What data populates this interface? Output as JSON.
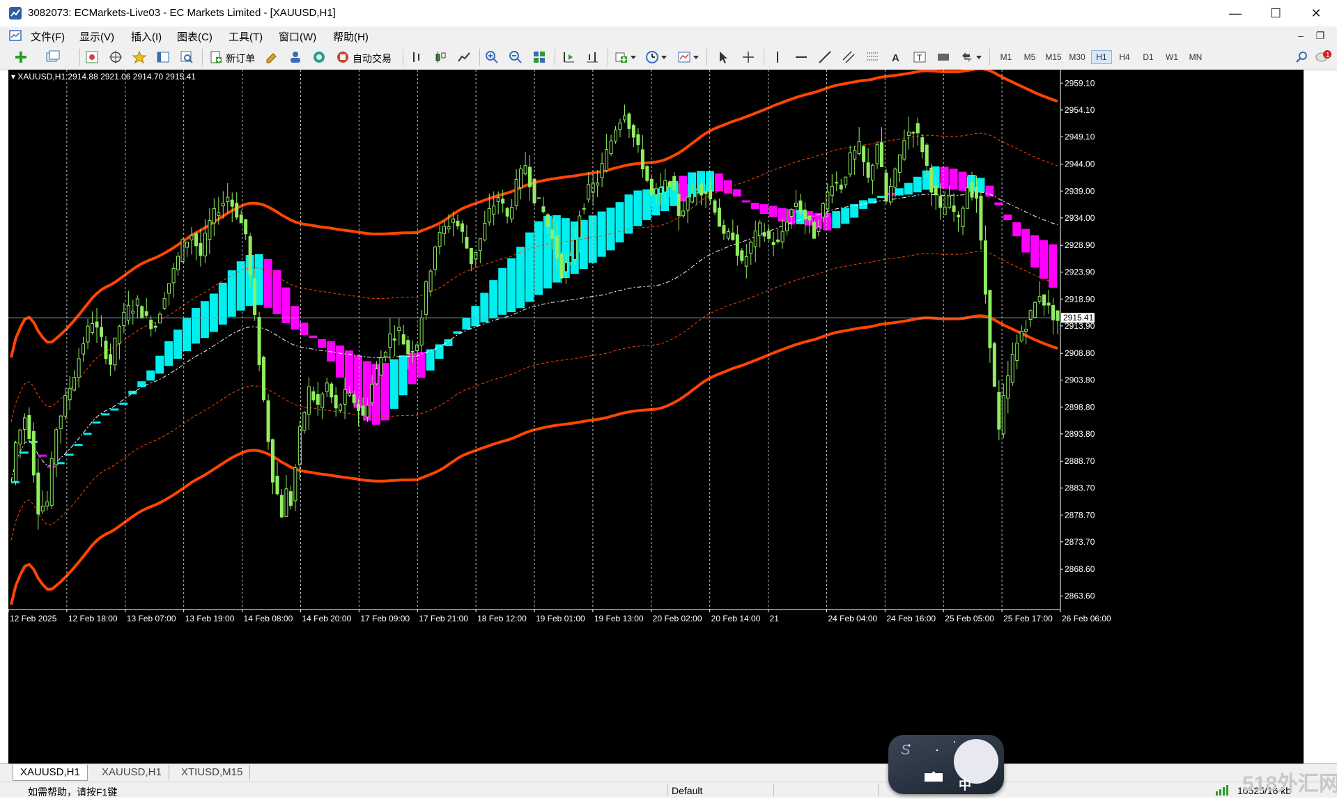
{
  "window": {
    "title": "3082073: ECMarkets-Live03 - EC Markets Limited - [XAUUSD,H1]",
    "minimize": "—",
    "maximize": "☐",
    "close": "✕"
  },
  "menu": {
    "items": [
      "文件(F)",
      "显示(V)",
      "插入(I)",
      "图表(C)",
      "工具(T)",
      "窗口(W)",
      "帮助(H)"
    ],
    "mdi_minimize": "‒",
    "mdi_restore": "❐"
  },
  "toolbar": {
    "new_order": "新订单",
    "auto_trading": "自动交易",
    "timeframes": [
      "M1",
      "M5",
      "M15",
      "M30",
      "H1",
      "H4",
      "D1",
      "W1",
      "MN"
    ],
    "active_timeframe": "H1",
    "notification_count": "1"
  },
  "chart": {
    "header": "XAUUSD,H1  2914.88 2921.06 2914.70 2915.41",
    "current_price_label": "2915.41",
    "price_ticks": [
      "2959.10",
      "2954.10",
      "2949.10",
      "2944.00",
      "2939.00",
      "2934.00",
      "2928.90",
      "2923.90",
      "2918.90",
      "2913.90",
      "2908.80",
      "2903.80",
      "2898.80",
      "2893.80",
      "2888.70",
      "2883.70",
      "2878.70",
      "2873.70",
      "2868.60",
      "2863.60"
    ],
    "time_ticks": [
      "12 Feb 2025",
      "12 Feb 18:00",
      "13 Feb 07:00",
      "13 Feb 19:00",
      "14 Feb 08:00",
      "14 Feb 20:00",
      "17 Feb 09:00",
      "17 Feb 21:00",
      "18 Feb 12:00",
      "19 Feb 01:00",
      "19 Feb 13:00",
      "20 Feb 02:00",
      "20 Feb 14:00",
      "21",
      "24 Feb 04:00",
      "24 Feb 16:00",
      "25 Feb 05:00",
      "25 Feb 17:00",
      "26 Feb 06:00"
    ],
    "colors": {
      "background": "#000000",
      "candle": "#90ee60",
      "cloud_up": "#00f0f0",
      "cloud_down": "#ff00ff",
      "band_outer": "#ff4500",
      "band_inner": "#ff4500",
      "midline": "#ffffff",
      "grid": "#c0c0c0"
    }
  },
  "chart_data": {
    "type": "candlestick",
    "symbol": "XAUUSD",
    "timeframe": "H1",
    "last": {
      "open": 2914.88,
      "high": 2921.06,
      "low": 2914.7,
      "close": 2915.41
    },
    "ylim": [
      2861.1,
      2961.6
    ],
    "x_labels": [
      "12 Feb 2025",
      "12 Feb 18:00",
      "13 Feb 07:00",
      "13 Feb 19:00",
      "14 Feb 08:00",
      "14 Feb 20:00",
      "17 Feb 09:00",
      "17 Feb 21:00",
      "18 Feb 12:00",
      "19 Feb 01:00",
      "19 Feb 13:00",
      "20 Feb 02:00",
      "20 Feb 14:00",
      "21",
      "24 Feb 04:00",
      "24 Feb 16:00",
      "25 Feb 05:00",
      "25 Feb 17:00",
      "26 Feb 06:00"
    ],
    "close_path": [
      [
        0,
        2885
      ],
      [
        1,
        2892
      ],
      [
        3,
        2897
      ],
      [
        4,
        2894
      ],
      [
        6,
        2880
      ],
      [
        8,
        2881
      ],
      [
        10,
        2895
      ],
      [
        12,
        2900
      ],
      [
        14,
        2905
      ],
      [
        16,
        2911
      ],
      [
        18,
        2915
      ],
      [
        20,
        2911
      ],
      [
        22,
        2907
      ],
      [
        24,
        2914
      ],
      [
        26,
        2917
      ],
      [
        28,
        2918
      ],
      [
        30,
        2915
      ],
      [
        32,
        2914
      ],
      [
        34,
        2920
      ],
      [
        36,
        2924
      ],
      [
        38,
        2929
      ],
      [
        40,
        2931
      ],
      [
        42,
        2927
      ],
      [
        44,
        2933
      ],
      [
        46,
        2936
      ],
      [
        48,
        2938
      ],
      [
        50,
        2935
      ],
      [
        52,
        2931
      ],
      [
        54,
        2915
      ],
      [
        56,
        2900
      ],
      [
        58,
        2886
      ],
      [
        60,
        2879
      ],
      [
        61,
        2883
      ],
      [
        62,
        2881
      ],
      [
        64,
        2894
      ],
      [
        66,
        2902
      ],
      [
        68,
        2899
      ],
      [
        70,
        2903
      ],
      [
        72,
        2898
      ],
      [
        74,
        2901
      ],
      [
        76,
        2900
      ],
      [
        78,
        2897
      ],
      [
        80,
        2903
      ],
      [
        82,
        2908
      ],
      [
        84,
        2912
      ],
      [
        86,
        2913
      ],
      [
        88,
        2909
      ],
      [
        90,
        2911
      ],
      [
        92,
        2921
      ],
      [
        94,
        2929
      ],
      [
        96,
        2932
      ],
      [
        98,
        2934
      ],
      [
        100,
        2931
      ],
      [
        102,
        2926
      ],
      [
        104,
        2930
      ],
      [
        106,
        2935
      ],
      [
        108,
        2938
      ],
      [
        110,
        2934
      ],
      [
        112,
        2940
      ],
      [
        114,
        2944
      ],
      [
        116,
        2938
      ],
      [
        118,
        2935
      ],
      [
        120,
        2930
      ],
      [
        122,
        2924
      ],
      [
        124,
        2926
      ],
      [
        126,
        2935
      ],
      [
        128,
        2939
      ],
      [
        130,
        2941
      ],
      [
        132,
        2946
      ],
      [
        134,
        2951
      ],
      [
        136,
        2954
      ],
      [
        138,
        2949
      ],
      [
        140,
        2944
      ],
      [
        142,
        2938
      ],
      [
        144,
        2939
      ],
      [
        146,
        2941
      ],
      [
        148,
        2935
      ],
      [
        150,
        2937
      ],
      [
        152,
        2940
      ],
      [
        154,
        2939
      ],
      [
        156,
        2936
      ],
      [
        158,
        2930
      ],
      [
        160,
        2931
      ],
      [
        162,
        2925
      ],
      [
        164,
        2929
      ],
      [
        166,
        2932
      ],
      [
        168,
        2930
      ],
      [
        170,
        2929
      ],
      [
        172,
        2934
      ],
      [
        174,
        2937
      ],
      [
        176,
        2934
      ],
      [
        178,
        2931
      ],
      [
        180,
        2936
      ],
      [
        182,
        2941
      ],
      [
        184,
        2940
      ],
      [
        186,
        2945
      ],
      [
        188,
        2947
      ],
      [
        190,
        2941
      ],
      [
        192,
        2948
      ],
      [
        194,
        2937
      ],
      [
        196,
        2942
      ],
      [
        198,
        2949
      ],
      [
        200,
        2951
      ],
      [
        202,
        2947
      ],
      [
        204,
        2940
      ],
      [
        206,
        2935
      ],
      [
        208,
        2937
      ],
      [
        210,
        2933
      ],
      [
        212,
        2940
      ],
      [
        214,
        2938
      ],
      [
        216,
        2920
      ],
      [
        218,
        2902
      ],
      [
        219,
        2894
      ],
      [
        220,
        2900
      ],
      [
        222,
        2908
      ],
      [
        224,
        2913
      ],
      [
        226,
        2916
      ],
      [
        228,
        2920
      ],
      [
        230,
        2917
      ],
      [
        232,
        2915
      ]
    ]
  },
  "tabs": [
    "XAUUSD,H1",
    "XAUUSD,H1",
    "XTIUSD,M15"
  ],
  "status": {
    "help": "如需帮助，请按F1键",
    "profile": "Default",
    "traffic": "10525/16 kb"
  },
  "ime": {
    "mode": "中"
  },
  "watermark": "518外汇网"
}
